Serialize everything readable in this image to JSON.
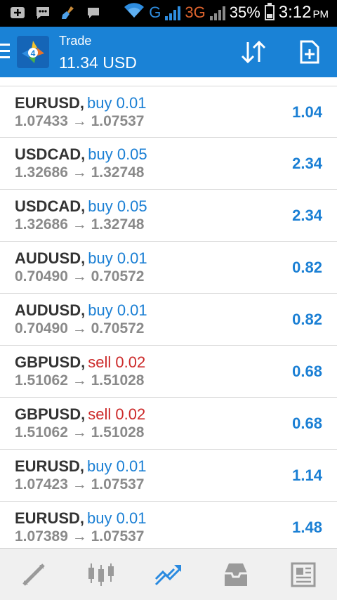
{
  "status_bar": {
    "network_g": "G",
    "network_3g": "3G",
    "battery_percent": "35%",
    "battery_level": 0.35,
    "time": "3:12",
    "ampm": "PM"
  },
  "header": {
    "title": "Trade",
    "balance": "11.34 USD"
  },
  "trades": [
    {
      "symbol": "EURUSD",
      "side": "buy",
      "volume": "buy 0.01",
      "prices": "1.07433 → 1.07537",
      "profit": "1.04"
    },
    {
      "symbol": "USDCAD",
      "side": "buy",
      "volume": "buy 0.05",
      "prices": "1.32686 → 1.32748",
      "profit": "2.34"
    },
    {
      "symbol": "USDCAD",
      "side": "buy",
      "volume": "buy 0.05",
      "prices": "1.32686 → 1.32748",
      "profit": "2.34"
    },
    {
      "symbol": "AUDUSD",
      "side": "buy",
      "volume": "buy 0.01",
      "prices": "0.70490 → 0.70572",
      "profit": "0.82"
    },
    {
      "symbol": "AUDUSD",
      "side": "buy",
      "volume": "buy 0.01",
      "prices": "0.70490 → 0.70572",
      "profit": "0.82"
    },
    {
      "symbol": "GBPUSD",
      "side": "sell",
      "volume": "sell 0.02",
      "prices": "1.51062 → 1.51028",
      "profit": "0.68"
    },
    {
      "symbol": "GBPUSD",
      "side": "sell",
      "volume": "sell 0.02",
      "prices": "1.51062 → 1.51028",
      "profit": "0.68"
    },
    {
      "symbol": "EURUSD",
      "side": "buy",
      "volume": "buy 0.01",
      "prices": "1.07423 → 1.07537",
      "profit": "1.14"
    },
    {
      "symbol": "EURUSD",
      "side": "buy",
      "volume": "buy 0.01",
      "prices": "1.07389 → 1.07537",
      "profit": "1.48"
    }
  ],
  "bottom_nav": [
    {
      "icon": "quotes-icon",
      "active": false
    },
    {
      "icon": "chart-icon",
      "active": false
    },
    {
      "icon": "trade-icon",
      "active": true
    },
    {
      "icon": "history-icon",
      "active": false
    },
    {
      "icon": "news-icon",
      "active": false
    }
  ],
  "colors": {
    "header_bg": "#1a82d6",
    "buy": "#1a7fd4",
    "sell": "#cc2a2a",
    "active_nav": "#2a8ae0",
    "inactive_nav": "#9a9a9a"
  }
}
